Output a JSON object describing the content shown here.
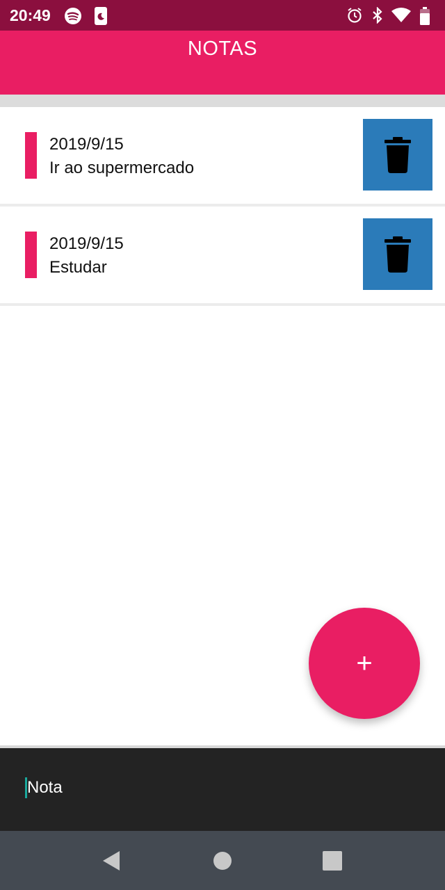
{
  "status_bar": {
    "time": "20:49",
    "icons_left": [
      "spotify-icon",
      "sleep-app-icon"
    ],
    "icons_right": [
      "alarm-icon",
      "bluetooth-icon",
      "wifi-icon",
      "battery-icon"
    ]
  },
  "header": {
    "title": "NOTAS"
  },
  "notes": [
    {
      "date": "2019/9/15",
      "text": "Ir ao supermercado"
    },
    {
      "date": "2019/9/15",
      "text": "Estudar"
    }
  ],
  "fab": {
    "label": "+"
  },
  "input": {
    "placeholder": "Nota"
  },
  "colors": {
    "status_bar": "#8b0f3e",
    "accent": "#e91e63",
    "delete_button": "#2b7bb9",
    "input_bar": "#232323",
    "nav_bar": "#444a52"
  }
}
